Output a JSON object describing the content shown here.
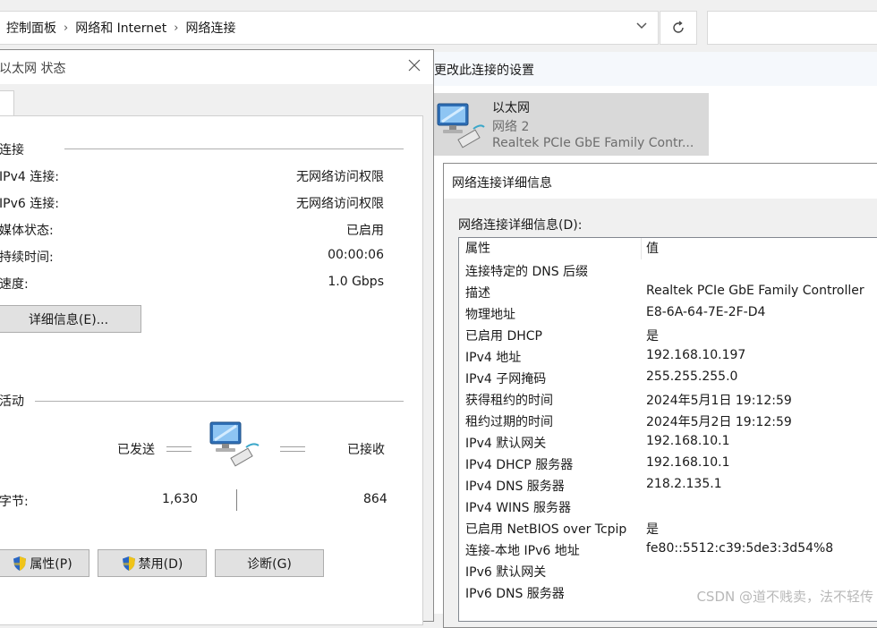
{
  "explorer": {
    "breadcrumb": [
      "控制面板",
      "网络和 Internet",
      "网络连接"
    ],
    "command_link": "更改此连接的设置",
    "adapter": {
      "name": "以太网",
      "network": "网络 2",
      "device": "Realtek PCIe GbE Family Contr..."
    }
  },
  "status_dialog": {
    "title": "以太网 状态",
    "connection_group": "连接",
    "rows": [
      {
        "label": "IPv4 连接:",
        "value": "无网络访问权限"
      },
      {
        "label": "IPv6 连接:",
        "value": "无网络访问权限"
      },
      {
        "label": "媒体状态:",
        "value": "已启用"
      },
      {
        "label": "持续时间:",
        "value": "00:00:06"
      },
      {
        "label": "速度:",
        "value": "1.0 Gbps"
      }
    ],
    "details_button": "详细信息(E)...",
    "activity_group": "活动",
    "sent_label": "已发送",
    "received_label": "已接收",
    "bytes_label": "字节:",
    "bytes_sent": "1,630",
    "bytes_received": "864",
    "buttons": {
      "properties": "属性(P)",
      "disable": "禁用(D)",
      "diagnose": "诊断(G)"
    }
  },
  "details_dialog": {
    "title": "网络连接详细信息",
    "list_label": "网络连接详细信息(D):",
    "columns": {
      "property": "属性",
      "value": "值"
    },
    "rows": [
      {
        "property": "连接特定的 DNS 后缀",
        "value": ""
      },
      {
        "property": "描述",
        "value": "Realtek PCIe GbE Family Controller"
      },
      {
        "property": "物理地址",
        "value": "E8-6A-64-7E-2F-D4"
      },
      {
        "property": "已启用 DHCP",
        "value": "是"
      },
      {
        "property": "IPv4 地址",
        "value": "192.168.10.197"
      },
      {
        "property": "IPv4 子网掩码",
        "value": "255.255.255.0"
      },
      {
        "property": "获得租约的时间",
        "value": "2024年5月1日 19:12:59"
      },
      {
        "property": "租约过期的时间",
        "value": "2024年5月2日 19:12:59"
      },
      {
        "property": "IPv4 默认网关",
        "value": "192.168.10.1"
      },
      {
        "property": "IPv4 DHCP 服务器",
        "value": "192.168.10.1"
      },
      {
        "property": "IPv4 DNS 服务器",
        "value": "218.2.135.1"
      },
      {
        "property": "IPv4 WINS 服务器",
        "value": ""
      },
      {
        "property": "已启用 NetBIOS over Tcpip",
        "value": "是"
      },
      {
        "property": "连接-本地 IPv6 地址",
        "value": "fe80::5512:c39:5de3:3d54%8"
      },
      {
        "property": "IPv6 默认网关",
        "value": ""
      },
      {
        "property": "IPv6 DNS 服务器",
        "value": ""
      }
    ]
  },
  "watermark": "CSDN @道不贱卖，法不轻传"
}
